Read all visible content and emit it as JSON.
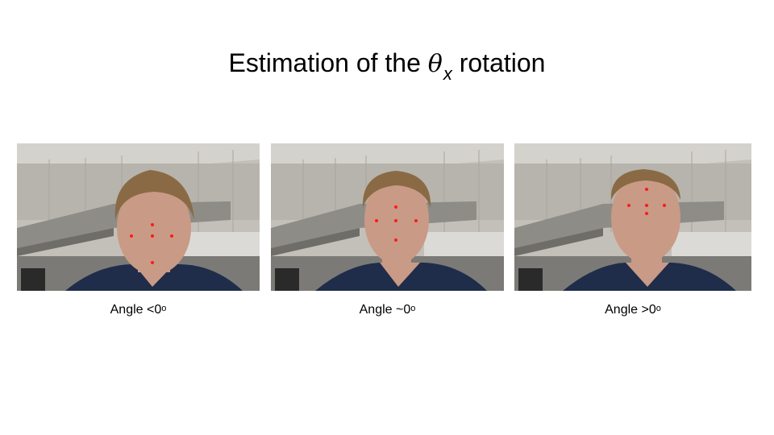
{
  "title": {
    "prefix": "Estimation of the",
    "symbol": "θ",
    "subscript": "x",
    "suffix": "rotation"
  },
  "panels": [
    {
      "caption_text": "Angle <0",
      "caption_sup": "o"
    },
    {
      "caption_text": "Angle ~0",
      "caption_sup": "o"
    },
    {
      "caption_text": "Angle >0",
      "caption_sup": "o"
    }
  ],
  "colors": {
    "landmark": "#ff1a1a",
    "wall": "#b9b6ae",
    "cabinet": "#8c8a84",
    "shirt": "#1f2c4a",
    "skin": "#c99a86",
    "hair": "#8a6a45"
  }
}
